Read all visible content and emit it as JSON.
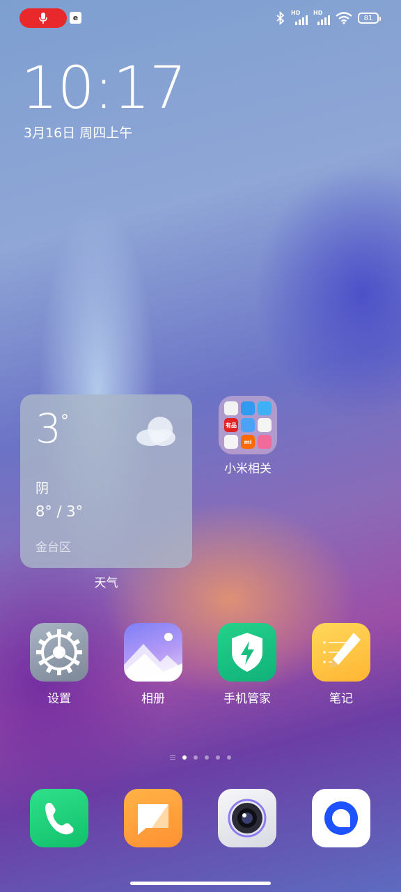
{
  "status_bar": {
    "badge_letter": "e",
    "battery_level": "81",
    "signal1_label": "HD",
    "signal2_label": "HD"
  },
  "lock_clock": {
    "time": "10:17",
    "date": "3月16日 周四上午"
  },
  "weather_widget": {
    "temperature": "3",
    "degree_symbol": "°",
    "condition": "阴",
    "range": "8° / 3°",
    "location": "金台区",
    "label": "天气"
  },
  "folder": {
    "label": "小米相关",
    "mini_icons": [
      {
        "name": "waveform-icon",
        "text": "",
        "color": "#f2f2f2"
      },
      {
        "name": "transfer-icon",
        "text": "",
        "color": "#2f9cf0"
      },
      {
        "name": "wallet-icon",
        "text": "",
        "color": "#3fb0f5"
      },
      {
        "name": "youpin-icon",
        "text": "有品",
        "color": "#e02323"
      },
      {
        "name": "mail-icon",
        "text": "",
        "color": "#4aa3f5"
      },
      {
        "name": "diamond-icon",
        "text": "",
        "color": "#f4f4f4"
      },
      {
        "name": "play-icon",
        "text": "",
        "color": "#f4f4f4"
      },
      {
        "name": "mi-icon",
        "text": "mi",
        "color": "#ff6a00"
      },
      {
        "name": "game-icon",
        "text": "",
        "color": "#f06a9a"
      }
    ]
  },
  "apps_row": [
    {
      "id": "settings",
      "label": "设置",
      "icon": "gear-icon"
    },
    {
      "id": "gallery",
      "label": "相册",
      "icon": "gallery-icon"
    },
    {
      "id": "security",
      "label": "手机管家",
      "icon": "shield-icon"
    },
    {
      "id": "notes",
      "label": "笔记",
      "icon": "notes-icon"
    }
  ],
  "page_indicator": {
    "pages": 5,
    "active": 1
  },
  "dock": [
    {
      "id": "phone",
      "icon": "phone-icon"
    },
    {
      "id": "messages",
      "icon": "message-icon"
    },
    {
      "id": "camera",
      "icon": "camera-icon"
    },
    {
      "id": "browser",
      "icon": "browser-icon"
    }
  ]
}
